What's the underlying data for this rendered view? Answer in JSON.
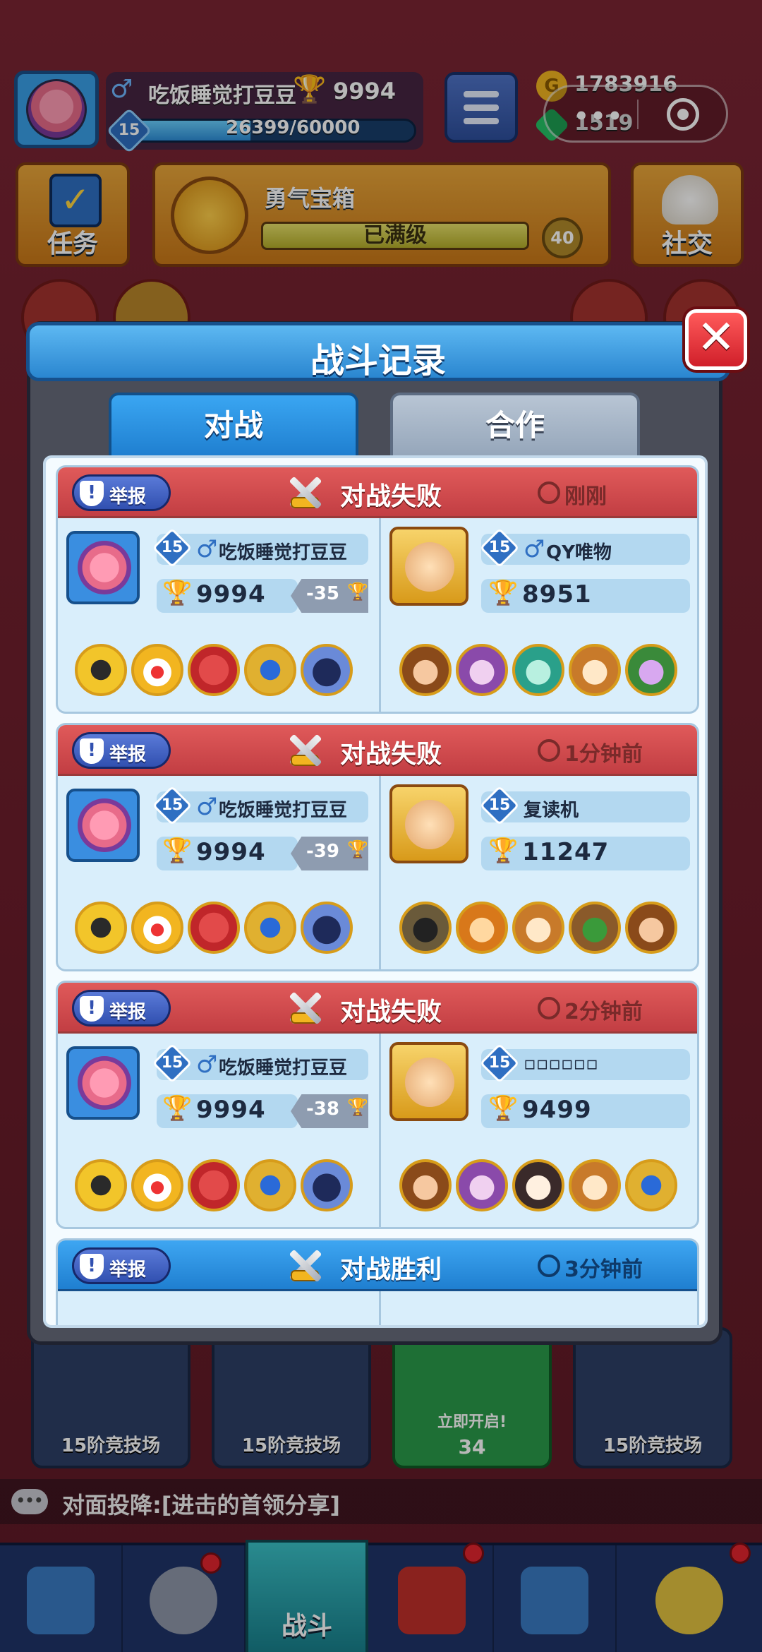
{
  "top": {
    "player_name": "吃饭睡觉打豆豆",
    "trophies": "9994",
    "level": "15",
    "xp": "26399/60000",
    "xp_fraction": 0.44,
    "gold": "1783916",
    "gems": "1519",
    "mini_menu_dots": "•••"
  },
  "buttons": {
    "quest": "任务",
    "social": "社交"
  },
  "chest": {
    "title": "勇气宝箱",
    "status": "已满级",
    "count": "40"
  },
  "modal": {
    "title": "战斗记录",
    "close": "✕",
    "tabs": [
      "对战",
      "合作"
    ]
  },
  "records": [
    {
      "report": "举报",
      "result": "对战失败",
      "time": "刚刚",
      "me": {
        "level": "15",
        "name": "吃饭睡觉打豆豆",
        "trophies": "9994",
        "delta": "-35"
      },
      "opp": {
        "level": "15",
        "name": "QY唯物",
        "trophies": "8951"
      }
    },
    {
      "report": "举报",
      "result": "对战失败",
      "time": "1分钟前",
      "me": {
        "level": "15",
        "name": "吃饭睡觉打豆豆",
        "trophies": "9994",
        "delta": "-39"
      },
      "opp": {
        "level": "15",
        "name": "复读机",
        "trophies": "11247"
      }
    },
    {
      "report": "举报",
      "result": "对战失败",
      "time": "2分钟前",
      "me": {
        "level": "15",
        "name": "吃饭睡觉打豆豆",
        "trophies": "9994",
        "delta": "-38"
      },
      "opp": {
        "level": "15",
        "name": "▫▫▫▫▫▫",
        "trophies": "9499"
      }
    },
    {
      "report": "举报",
      "result": "对战胜利",
      "time": "3分钟前"
    }
  ],
  "bottom_chests": [
    {
      "label": "15阶竞技场"
    },
    {
      "label": "15阶竞技场"
    },
    {
      "label": "立即开启!",
      "cost": "34"
    },
    {
      "label": "15阶竞技场"
    }
  ],
  "chat": {
    "icon": "•••",
    "text": "对面投降:[进击的首领分享]"
  },
  "nav": {
    "battle_label": "战斗"
  },
  "colors": {
    "lose_header": "#c23e43",
    "win_header": "#1f7fd0",
    "accent_blue": "#2a86d0"
  },
  "icons": {
    "trophy": "🏆",
    "male": "♂",
    "shield": "!"
  }
}
